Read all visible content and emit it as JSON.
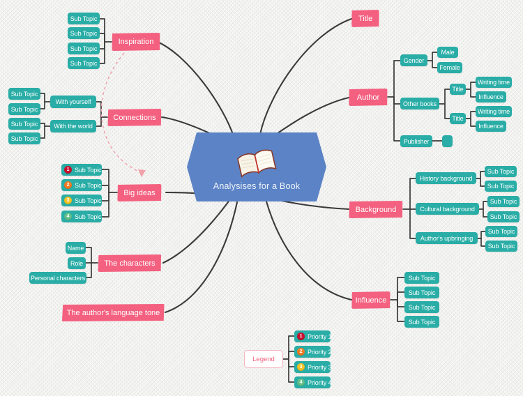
{
  "diagram": {
    "title": "Analysises for a Book",
    "type": "mind-map",
    "background_color": "#f1f1ef",
    "colors": {
      "central": "#5b83c6",
      "main_topic": "#f4607f",
      "sub_topic": "#29ada6",
      "branch_line": "#3a3a3a",
      "relationship_line": "#f0a0a8",
      "legend_border": "#f3b4bd"
    }
  },
  "central": {
    "label": "Analysises for a Book",
    "icon": "open-book-icon"
  },
  "main_topics": [
    {
      "id": "inspiration",
      "label": "Inspiration",
      "children": [
        {
          "label": "Sub Topic"
        },
        {
          "label": "Sub Topic"
        },
        {
          "label": "Sub Topic"
        },
        {
          "label": "Sub Topic"
        }
      ]
    },
    {
      "id": "connections",
      "label": "Connections",
      "children": [
        {
          "label": "With yourself",
          "children": [
            {
              "label": "Sub Topic"
            },
            {
              "label": "Sub Topic"
            }
          ]
        },
        {
          "label": "With the world",
          "children": [
            {
              "label": "Sub Topic"
            },
            {
              "label": "Sub Topic"
            }
          ]
        }
      ]
    },
    {
      "id": "big-ideas",
      "label": "Big ideas",
      "children": [
        {
          "label": "Sub Topic",
          "priority": "1"
        },
        {
          "label": "Sub Topic",
          "priority": "2"
        },
        {
          "label": "Sub Topic",
          "priority": "3"
        },
        {
          "label": "Sub Topic",
          "priority": "4"
        }
      ]
    },
    {
      "id": "the-characters",
      "label": "The characters",
      "children": [
        {
          "label": "Name"
        },
        {
          "label": "Role"
        },
        {
          "label": "Personal characters"
        }
      ]
    },
    {
      "id": "language-tone",
      "label": "The author's language tone",
      "children": []
    },
    {
      "id": "title",
      "label": "Title",
      "children": []
    },
    {
      "id": "author",
      "label": "Author",
      "children": [
        {
          "label": "Gender",
          "children": [
            {
              "label": "Male"
            },
            {
              "label": "Female"
            }
          ]
        },
        {
          "label": "Other books",
          "children": [
            {
              "label": "Title",
              "children": [
                {
                  "label": "Writing time"
                },
                {
                  "label": "Influence"
                }
              ]
            },
            {
              "label": "Title",
              "children": [
                {
                  "label": "Writing time"
                },
                {
                  "label": "Influence"
                }
              ]
            }
          ]
        },
        {
          "label": "Publisher",
          "children": [
            {
              "label": ""
            }
          ]
        }
      ]
    },
    {
      "id": "background",
      "label": "Background",
      "children": [
        {
          "label": "History background",
          "children": [
            {
              "label": "Sub Topic"
            },
            {
              "label": "Sub Topic"
            }
          ]
        },
        {
          "label": "Cultural background",
          "children": [
            {
              "label": "Sub Topic"
            },
            {
              "label": "Sub Topic"
            }
          ]
        },
        {
          "label": "Author's upbringing",
          "children": [
            {
              "label": "Sub Topic"
            },
            {
              "label": "Sub Topic"
            }
          ]
        }
      ]
    },
    {
      "id": "influence",
      "label": "Influence",
      "children": [
        {
          "label": "Sub Topic"
        },
        {
          "label": "Sub Topic"
        },
        {
          "label": "Sub Topic"
        },
        {
          "label": "Sub Topic"
        }
      ]
    }
  ],
  "legend": {
    "label": "Legend",
    "items": [
      {
        "number": "1",
        "label": "Priority 1",
        "color": "#c8102e"
      },
      {
        "number": "2",
        "label": "Priority 2",
        "color": "#f07c24"
      },
      {
        "number": "3",
        "label": "Priority 3",
        "color": "#f5c327"
      },
      {
        "number": "4",
        "label": "Priority 4",
        "color": "#63c08a"
      }
    ]
  },
  "nodes": {
    "insp_s1": "Sub Topic",
    "insp_s2": "Sub Topic",
    "insp_s3": "Sub Topic",
    "insp_s4": "Sub Topic",
    "conn_a": "With yourself",
    "conn_b": "With the world",
    "conn_a1": "Sub Topic",
    "conn_a2": "Sub Topic",
    "conn_b1": "Sub Topic",
    "conn_b2": "Sub Topic",
    "big_1": "Sub Topic",
    "big_2": "Sub Topic",
    "big_3": "Sub Topic",
    "big_4": "Sub Topic",
    "char_name": "Name",
    "char_role": "Role",
    "char_pers": "Personal characters",
    "auth_gender": "Gender",
    "auth_male": "Male",
    "auth_female": "Female",
    "auth_other": "Other books",
    "auth_t1": "Title",
    "auth_t1_w": "Writing time",
    "auth_t1_i": "Influence",
    "auth_t2": "Title",
    "auth_t2_w": "Writing time",
    "auth_t2_i": "Influence",
    "auth_pub": "Publisher",
    "auth_pub_empty": "",
    "bg_hist": "History background",
    "bg_hist_1": "Sub Topic",
    "bg_hist_2": "Sub Topic",
    "bg_cult": "Cultural background",
    "bg_cult_1": "Sub Topic",
    "bg_cult_2": "Sub Topic",
    "bg_upbr": "Author's upbringing",
    "bg_upbr_1": "Sub Topic",
    "bg_upbr_2": "Sub Topic",
    "infl_1": "Sub Topic",
    "infl_2": "Sub Topic",
    "infl_3": "Sub Topic",
    "infl_4": "Sub Topic"
  }
}
